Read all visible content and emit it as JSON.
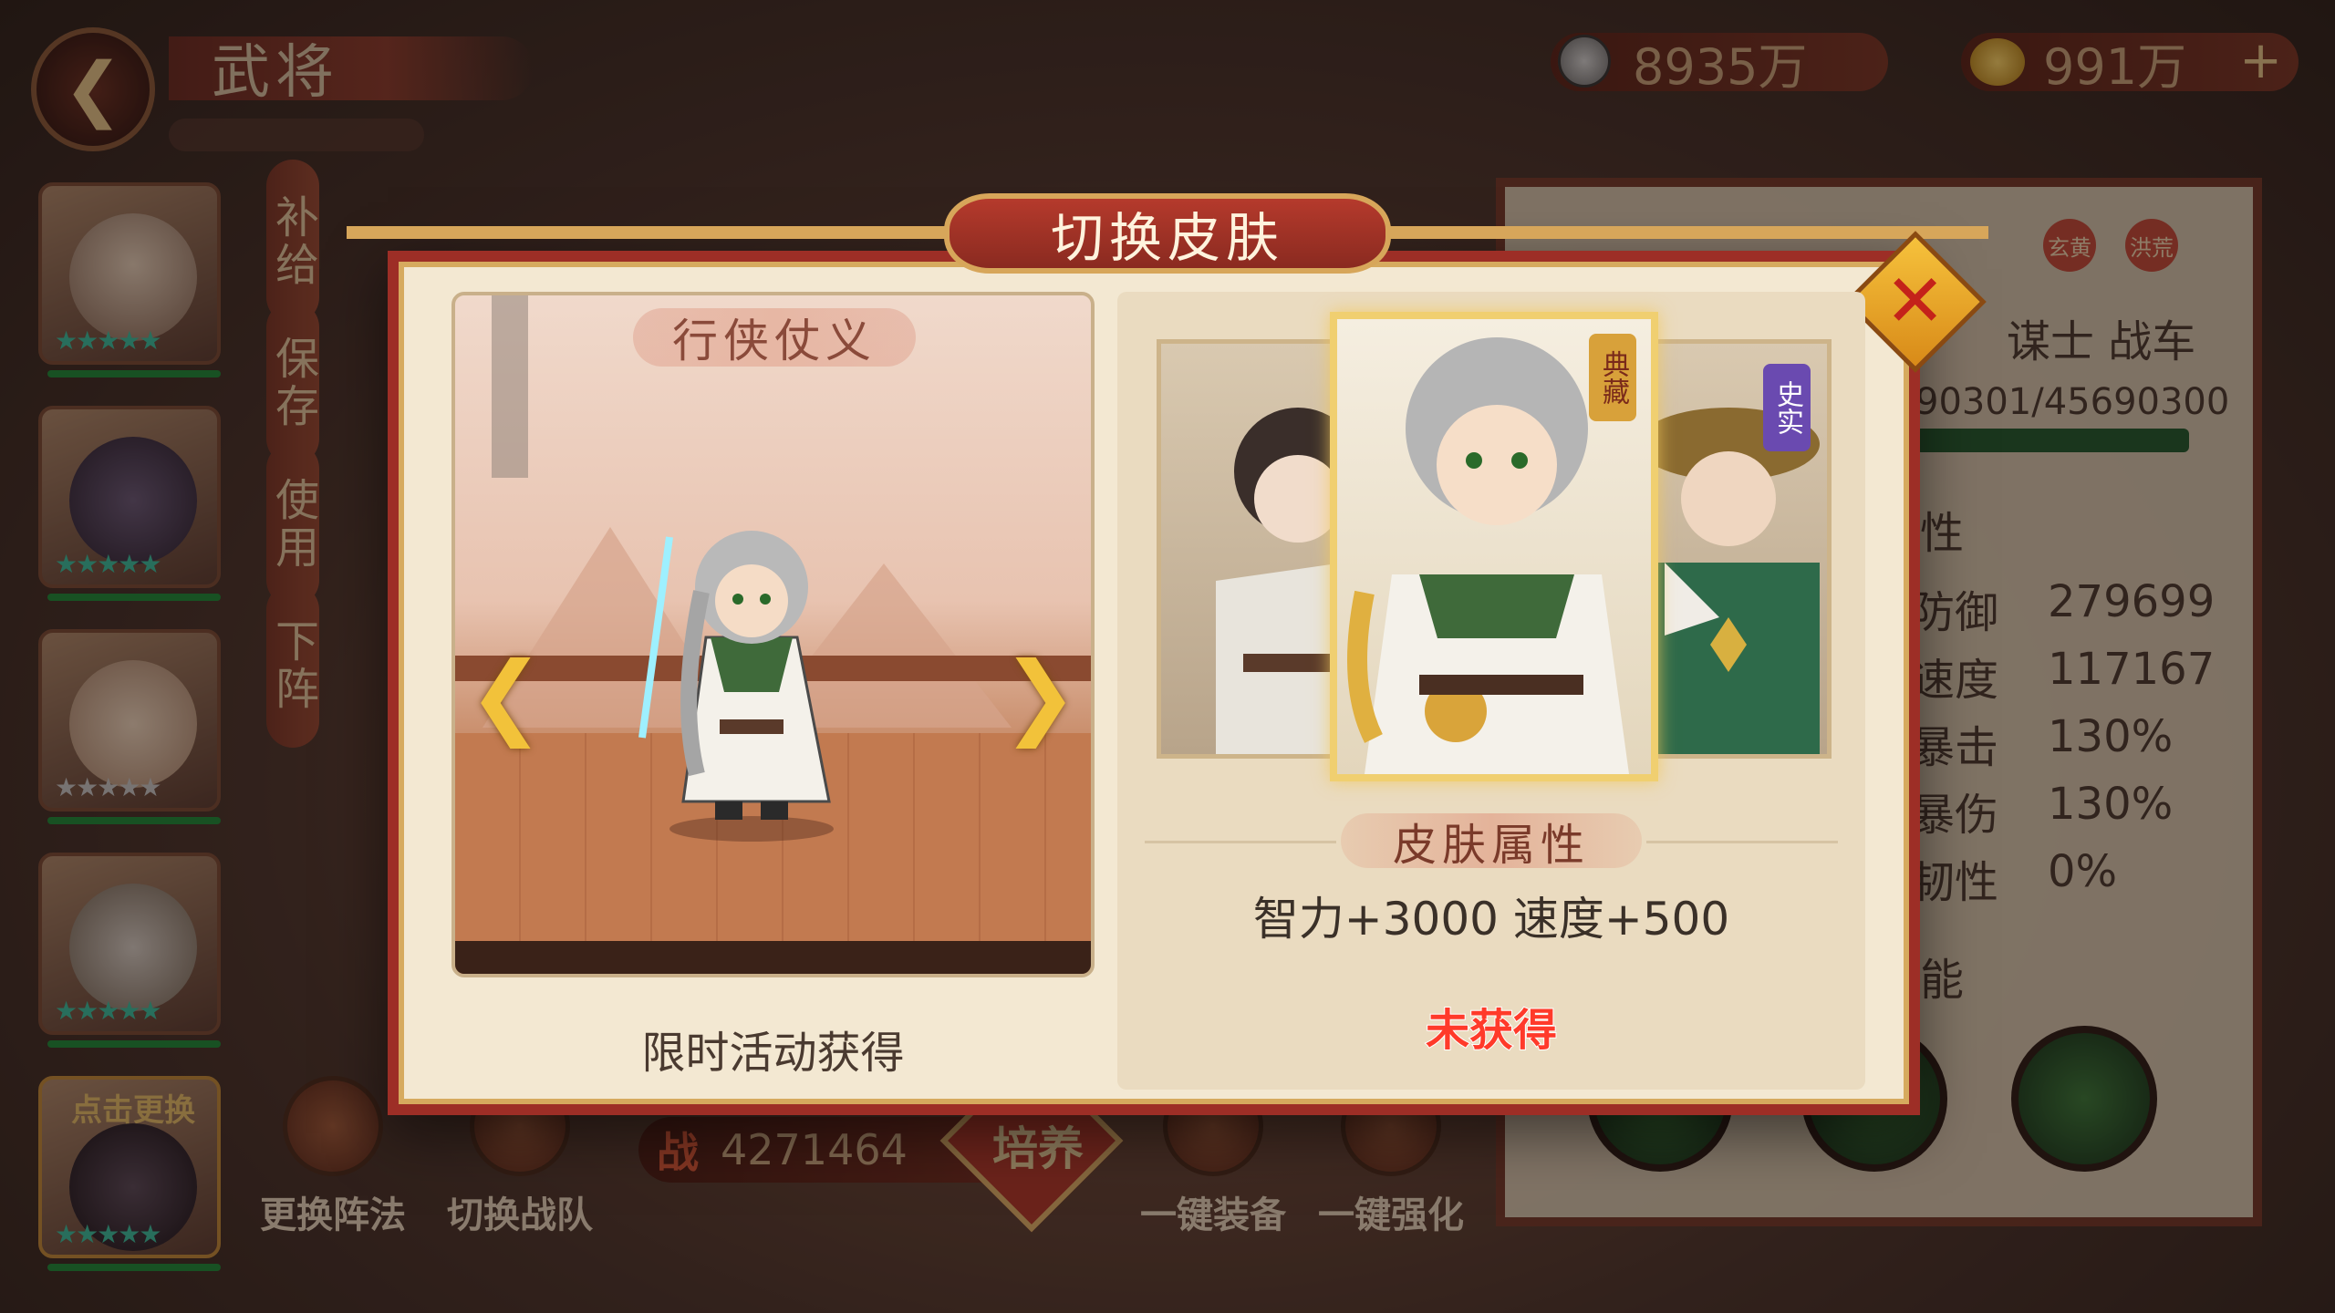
{
  "header": {
    "title": "武将"
  },
  "currencies": [
    {
      "icon": "coin-icon",
      "value": "8935万"
    },
    {
      "icon": "gold-ingot-icon",
      "value": "991万"
    }
  ],
  "side_tabs": [
    "补给",
    "保存",
    "使用",
    "下阵"
  ],
  "roster": {
    "swap_label": "点击更换",
    "stars": "★★★★★"
  },
  "right_panel": {
    "tags": [
      "玄黄",
      "洪荒"
    ],
    "roles": "谋士 战车",
    "hp_text": "90301/45690300",
    "section_title": "性",
    "stats": [
      {
        "label": "防御",
        "value": "279699"
      },
      {
        "label": "速度",
        "value": "117167"
      },
      {
        "label": "暴击",
        "value": "130%"
      },
      {
        "label": "暴伤",
        "value": "130%"
      },
      {
        "label": "韧性",
        "value": "0%"
      }
    ],
    "skills_title": "能"
  },
  "bottom_bar": {
    "buttons": [
      "更换阵法",
      "切换战队",
      "一键装备",
      "一键强化"
    ],
    "power_label": "战",
    "power_value": "4271464",
    "center_label": "培养"
  },
  "dialog": {
    "title": "切换皮肤",
    "skin_name": "行侠仗义",
    "acquire_text": "限时活动获得",
    "badges": {
      "main": "典藏",
      "right": "史实"
    },
    "attr_title": "皮肤属性",
    "attr_values": "智力+3000  速度+500",
    "status": "未获得"
  },
  "colors": {
    "frame_red": "#9d2e26",
    "gold_trim": "#d6aa5e",
    "parchment": "#f3e8d2",
    "status_red": "#ff3a2a",
    "accent_yellow": "#f2c23a"
  }
}
